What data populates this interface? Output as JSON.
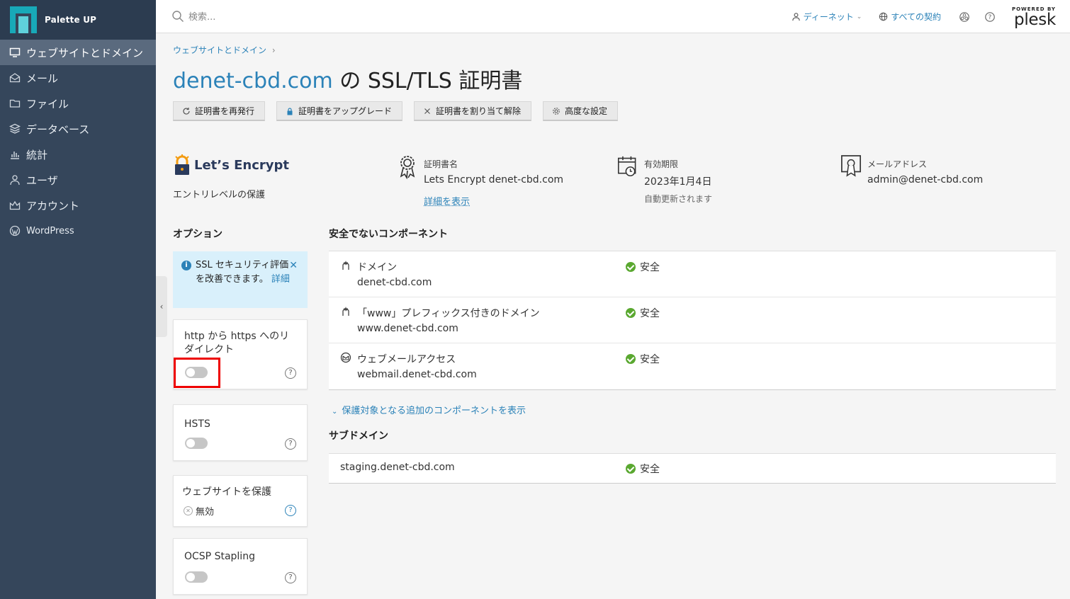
{
  "app": {
    "name": "Palette UP"
  },
  "sidebar": {
    "items": [
      {
        "label": "ウェブサイトとドメイン",
        "icon": "monitor-icon"
      },
      {
        "label": "メール",
        "icon": "mail-icon"
      },
      {
        "label": "ファイル",
        "icon": "folder-icon"
      },
      {
        "label": "データベース",
        "icon": "database-icon"
      },
      {
        "label": "統計",
        "icon": "stats-icon"
      },
      {
        "label": "ユーザ",
        "icon": "user-icon"
      },
      {
        "label": "アカウント",
        "icon": "account-icon"
      },
      {
        "label": "WordPress",
        "icon": "wordpress-icon"
      }
    ]
  },
  "topbar": {
    "search_placeholder": "検索...",
    "user_label": "ディーネット",
    "subscriptions_label": "すべての契約",
    "powered_by": "POWERED BY",
    "plesk": "plesk"
  },
  "breadcrumb": {
    "label": "ウェブサイトとドメイン"
  },
  "title": {
    "domain": "denet-cbd.com",
    "suffix": " の SSL/TLS 証明書"
  },
  "toolbar": {
    "reissue": "証明書を再発行",
    "upgrade": "証明書をアップグレード",
    "unassign": "証明書を割り当て解除",
    "advanced": "高度な設定"
  },
  "provider": {
    "name": "Let’s Encrypt",
    "level": "エントリレベルの保護"
  },
  "cert": {
    "name_label": "証明書名",
    "name_value": "Lets Encrypt denet-cbd.com",
    "details_link": "詳細を表示",
    "expiry_label": "有効期限",
    "expiry_value": "2023年1月4日",
    "expiry_note": "自動更新されます",
    "email_label": "メールアドレス",
    "email_value": "admin@denet-cbd.com"
  },
  "options": {
    "heading": "オプション",
    "alert_text": "SSL セキュリティ評価を改善できます。",
    "alert_link": "詳細",
    "redirect": {
      "label": "http から https へのリダイレクト",
      "enabled": false
    },
    "hsts": {
      "label": "HSTS",
      "enabled": false
    },
    "protect": {
      "label": "ウェブサイトを保護",
      "state": "無効"
    },
    "ocsp": {
      "label": "OCSP Stapling",
      "enabled": false
    }
  },
  "insecure": {
    "heading": "安全でないコンポーネント",
    "rows": [
      {
        "name": "ドメイン",
        "sub": "denet-cbd.com",
        "status": "安全",
        "icon": "domain-icon"
      },
      {
        "name": "「www」プレフィックス付きのドメイン",
        "sub": "www.denet-cbd.com",
        "status": "安全",
        "icon": "domain-icon"
      },
      {
        "name": "ウェブメールアクセス",
        "sub": "webmail.denet-cbd.com",
        "status": "安全",
        "icon": "webmail-icon"
      }
    ],
    "more_link": "保護対象となる追加のコンポーネントを表示"
  },
  "subdomains": {
    "heading": "サブドメイン",
    "rows": [
      {
        "name": "staging.denet-cbd.com",
        "status": "安全"
      }
    ]
  },
  "colors": {
    "sidebar": "#35465b",
    "accent": "#2b82b8",
    "ok": "#5aa830",
    "highlight": "#ee0000"
  }
}
